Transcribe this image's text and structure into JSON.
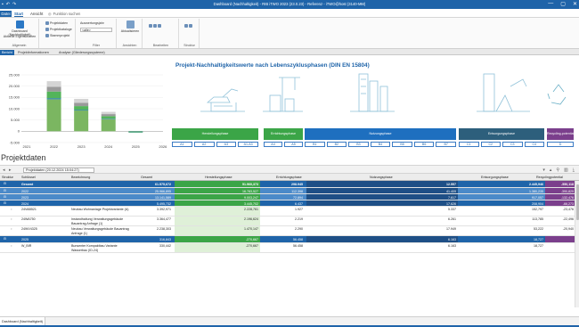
{
  "titlebar": {
    "title": "Dashboard (Nachhaltigkeit) - RIB iTWO 2023 (23.0.23) - Referenz - iTWO@host (3140-MM)",
    "window_controls": [
      "—",
      "▢",
      "✕"
    ]
  },
  "menubar": {
    "datei": "Datei",
    "start": "Start",
    "ansicht": "Ansicht",
    "search_placeholder": "Funktion suchen"
  },
  "ribbon": {
    "allgemein": {
      "label": "Allgemein",
      "btn1": "Dashboard (Nachhaltigkeit)",
      "btn2": "Aktuelle Eigenschaften"
    },
    "projekt": {
      "label": "",
      "item1": "Projektdaten",
      "item2": "Projektkataloge",
      "item3": "Stammprojekt"
    },
    "filter": {
      "label": "Filter",
      "auswertung": "Auswertungsjahr",
      "alle": "<alle>"
    },
    "ansicht": {
      "label": "Ansichten",
      "btn": "Aktualisieren"
    },
    "bearbeiten": {
      "label": "Bearbeiten"
    },
    "struktur": {
      "label": "Struktur"
    }
  },
  "doctabs": {
    "t1": "Bericht",
    "t2": "Projektinformationen",
    "t3": "Analyse (Gliederungssysteme)"
  },
  "chart_data": {
    "type": "bar",
    "categories": [
      "2021",
      "2022",
      "2023",
      "2024",
      "2025",
      "2026"
    ],
    "xticks": [
      "2021",
      "2022",
      "2023",
      "2024",
      "2025",
      "2026"
    ],
    "yticks": [
      "25.000",
      "20.000",
      "15.000",
      "10.000",
      "5.000",
      "0",
      "-5.000"
    ],
    "ylim": [
      -5000,
      25000
    ],
    "series": [
      {
        "color": "#7bb661",
        "values": [
          0,
          14200,
          9200,
          5400,
          0,
          0
        ]
      },
      {
        "color": "#1e6fbf",
        "values": [
          0,
          400,
          250,
          200,
          0,
          0
        ]
      },
      {
        "color": "#53b45a",
        "values": [
          0,
          3000,
          1700,
          1100,
          0,
          0
        ]
      },
      {
        "color": "#9a9a9a",
        "values": [
          0,
          2100,
          1500,
          900,
          0,
          0
        ]
      },
      {
        "color": "#d4d4d4",
        "values": [
          0,
          2500,
          1700,
          1000,
          0,
          0
        ]
      },
      {
        "color": "#4aa47e",
        "values": [
          0,
          0,
          0,
          0,
          -600,
          0
        ]
      }
    ]
  },
  "lifecycle": {
    "title": "Projekt-Nachhaltigkeitswerte nach Lebenszyklusphasen (DIN EN 15804)",
    "phases": [
      {
        "name": "Herstellungsphase",
        "color": "#3ba547"
      },
      {
        "name": "Errichtungsphase",
        "color": "#3ba547"
      },
      {
        "name": "Nutzungsphase",
        "color": "#1e6fbf"
      },
      {
        "name": "Entsorgungsphase",
        "color": "#2d5f7c"
      },
      {
        "name": "Recycling-potential",
        "color": "#7b3f8c"
      }
    ],
    "modules": [
      "A1",
      "A2",
      "A3",
      "A1-A3",
      "A4",
      "A5",
      "B1",
      "B2",
      "B3",
      "B4",
      "B5",
      "B6",
      "B7",
      "C1",
      "C2",
      "C3",
      "C4",
      "D"
    ]
  },
  "section": {
    "title": "Projektdaten"
  },
  "gridtool": {
    "dropdown": "Projektdaten (20.12.2024 15:04:27)"
  },
  "grid": {
    "headers": {
      "struktur": "Struktur",
      "schluessel": "Schlüssel",
      "bezeichnung": "Bezeichnung",
      "gesamt": "Gesamt",
      "herstellung": "Herstellungsphase",
      "errichtung": "Errichtungsphase",
      "nutzung": "Nutzungsphase",
      "entsorgung": "Entsorgungsphase",
      "recycling": "Recyclingpotential"
    },
    "rows": [
      {
        "key": "Gesamt",
        "name": "",
        "gesamt": "61.575,672",
        "herstellung": "51.960,373",
        "errichtung": "298.945",
        "nutzung": "12.557",
        "entsorgung": "2.445,946",
        "recycling": "-550,118",
        "style": "total"
      },
      {
        "key": "2022",
        "name": "",
        "gesamt": "25.966,895",
        "herstellung": "16.783,527",
        "errichtung": "112.398",
        "nutzung": "41.409",
        "entsorgung": "1.380,235",
        "recycling": "-390,829",
        "style": "year"
      },
      {
        "key": "2023",
        "name": "",
        "gesamt": "13.141,589",
        "herstellung": "9.003,247",
        "errichtung": "72.894",
        "nutzung": "7.617",
        "entsorgung": "917,057",
        "recycling": "-132,476",
        "style": "year"
      },
      {
        "key": "2024",
        "name": "",
        "gesamt": "5.495,732",
        "herstellung": "3.445,702",
        "errichtung": "6.437",
        "nutzung": "17.626",
        "entsorgung": "208,904",
        "recycling": "-66,273",
        "style": "yearsel"
      },
      {
        "key": "24VAB521",
        "name": "Neubau Wohnanlage Projektvariante (A)",
        "gesamt": "3.392,971",
        "herstellung": "2.228,761",
        "errichtung": "1.927",
        "nutzung": "5.337",
        "entsorgung": "152,797",
        "recycling": "-23,476",
        "style": "item"
      },
      {
        "key": "24WA750",
        "name": "Instandhaltung Verwaltungsgebäude Bauantrag Anfrage (1)",
        "gesamt": "3.364,477",
        "herstellung": "2.196,624",
        "errichtung": "2.219",
        "nutzung": "6.261",
        "entsorgung": "113,785",
        "recycling": "-22,496",
        "style": "item"
      },
      {
        "key": "24WV4325",
        "name": "Neubau Verwaltungsgebäude Bauantrag Anfrage (1)",
        "gesamt": "2.238,303",
        "herstellung": "1.470,147",
        "errichtung": "2.290",
        "nutzung": "17.949",
        "entsorgung": "53,222",
        "recycling": "-20,940",
        "style": "item"
      },
      {
        "key": "2025",
        "name": "",
        "gesamt": "316,843",
        "herstellung": "-270,667",
        "errichtung": "56.458",
        "nutzung": "6.163",
        "entsorgung": "18,727",
        "recycling": "",
        "style": "year2"
      },
      {
        "key": "W_BIR",
        "name": "Bunsenter Kompaktbau Variante Wasserbau (ID-24)",
        "gesamt": "330,442",
        "herstellung": "-270,667",
        "errichtung": "56.458",
        "nutzung": "6.163",
        "entsorgung": "18,727",
        "recycling": "",
        "style": "item"
      }
    ]
  },
  "statusbar": {
    "tab": "Dashboard (Nachhaltigkeit)"
  }
}
